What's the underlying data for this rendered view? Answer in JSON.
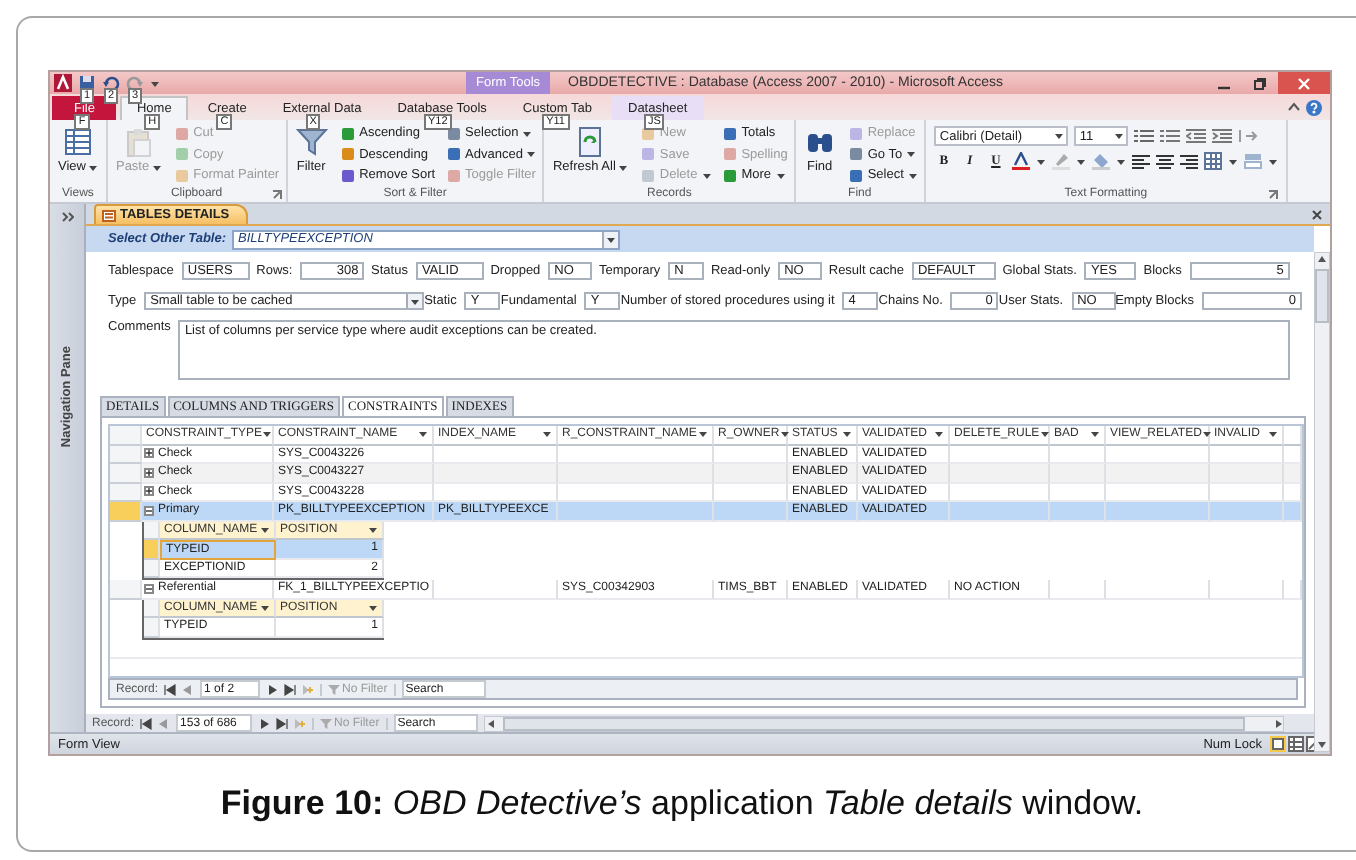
{
  "window": {
    "title": "OBDDETECTIVE : Database (Access 2007 - 2010) - Microsoft Access",
    "context_label": "Form Tools"
  },
  "quick_access": [
    {
      "keytip": "1"
    },
    {
      "keytip": "2"
    },
    {
      "keytip": "3"
    }
  ],
  "ribbon_tabs": [
    {
      "label": "File",
      "keytip": "F",
      "kind": "file",
      "selected": false
    },
    {
      "label": "Home",
      "keytip": "H",
      "kind": "normal",
      "selected": true
    },
    {
      "label": "Create",
      "keytip": "C",
      "kind": "normal",
      "selected": false
    },
    {
      "label": "External Data",
      "keytip": "X",
      "kind": "normal",
      "selected": false
    },
    {
      "label": "Database Tools",
      "keytip": "Y12",
      "kind": "normal",
      "selected": false
    },
    {
      "label": "Custom Tab",
      "keytip": "Y11",
      "kind": "normal",
      "selected": false
    },
    {
      "label": "Datasheet",
      "keytip": "JS",
      "kind": "context",
      "selected": false
    }
  ],
  "ribbon_groups": [
    {
      "label": "Views",
      "launcher": false,
      "items": [
        {
          "label": "View",
          "kind": "large",
          "dropdown": true,
          "disabled": false
        }
      ]
    },
    {
      "label": "Clipboard",
      "launcher": true,
      "items": [
        {
          "label": "Paste",
          "kind": "large",
          "dropdown": true,
          "disabled": true
        },
        {
          "label": "Cut",
          "kind": "small",
          "dropdown": false,
          "disabled": true
        },
        {
          "label": "Copy",
          "kind": "small",
          "dropdown": false,
          "disabled": true
        },
        {
          "label": "Format Painter",
          "kind": "small",
          "dropdown": false,
          "disabled": true
        }
      ]
    },
    {
      "label": "Sort & Filter",
      "launcher": false,
      "items": [
        {
          "label": "Filter",
          "kind": "large",
          "dropdown": false,
          "disabled": false
        },
        {
          "label": "Ascending",
          "kind": "small",
          "dropdown": false,
          "disabled": false
        },
        {
          "label": "Descending",
          "kind": "small",
          "dropdown": false,
          "disabled": false
        },
        {
          "label": "Remove Sort",
          "kind": "small",
          "dropdown": false,
          "disabled": false
        },
        {
          "label": "Selection",
          "kind": "small",
          "dropdown": true,
          "disabled": false
        },
        {
          "label": "Advanced",
          "kind": "small",
          "dropdown": true,
          "disabled": false
        },
        {
          "label": "Toggle Filter",
          "kind": "small",
          "dropdown": false,
          "disabled": true
        }
      ]
    },
    {
      "label": "Records",
      "launcher": false,
      "items": [
        {
          "label": "Refresh All",
          "kind": "large",
          "dropdown": true,
          "disabled": false
        },
        {
          "label": "New",
          "kind": "small",
          "dropdown": false,
          "disabled": true
        },
        {
          "label": "Save",
          "kind": "small",
          "dropdown": false,
          "disabled": true
        },
        {
          "label": "Delete",
          "kind": "small",
          "dropdown": true,
          "disabled": true
        },
        {
          "label": "Totals",
          "kind": "small",
          "dropdown": false,
          "disabled": false
        },
        {
          "label": "Spelling",
          "kind": "small",
          "dropdown": false,
          "disabled": true
        },
        {
          "label": "More",
          "kind": "small",
          "dropdown": true,
          "disabled": false
        }
      ]
    },
    {
      "label": "Find",
      "launcher": false,
      "items": [
        {
          "label": "Find",
          "kind": "large",
          "dropdown": false,
          "disabled": false
        },
        {
          "label": "Replace",
          "kind": "small",
          "dropdown": false,
          "disabled": true
        },
        {
          "label": "Go To",
          "kind": "small",
          "dropdown": true,
          "disabled": false
        },
        {
          "label": "Select",
          "kind": "small",
          "dropdown": true,
          "disabled": false
        }
      ]
    }
  ],
  "text_formatting": {
    "label": "Text Formatting",
    "launcher": true,
    "font": "Calibri (Detail)",
    "size": "11",
    "style_buttons": [
      "B",
      "I",
      "U"
    ]
  },
  "navigation_pane": {
    "label": "Navigation Pane"
  },
  "document_tab": {
    "label": "TABLES DETAILS"
  },
  "table_selector": {
    "label": "Select Other Table:",
    "value": "BILLTYPEEXCEPTION"
  },
  "field_rows": [
    [
      {
        "label": "Tablespace",
        "value": "USERS",
        "kind": "text"
      },
      {
        "label": "Rows:",
        "value": "308",
        "kind": "number"
      },
      {
        "label": "Status",
        "value": "VALID",
        "kind": "text"
      },
      {
        "label": "Dropped",
        "value": "NO",
        "kind": "text"
      },
      {
        "label": "Temporary",
        "value": "N",
        "kind": "text"
      },
      {
        "label": "Read-only",
        "value": "NO",
        "kind": "text"
      },
      {
        "label": "Result cache",
        "value": "DEFAULT",
        "kind": "text"
      },
      {
        "label": "Global Stats.",
        "value": "YES",
        "kind": "text"
      },
      {
        "label": "Blocks",
        "value": "5",
        "kind": "number"
      }
    ],
    [
      {
        "label": "Type",
        "value": "Small table to be cached",
        "kind": "combo"
      },
      {
        "label": "Static",
        "value": "Y",
        "kind": "text"
      },
      {
        "label": "Fundamental",
        "value": "Y",
        "kind": "text"
      },
      {
        "label": "Number of stored procedures using it",
        "value": "4",
        "kind": "text"
      },
      {
        "label": "Chains No.",
        "value": "0",
        "kind": "number"
      },
      {
        "label": "User Stats.",
        "value": "NO",
        "kind": "text"
      },
      {
        "label": "Empty Blocks",
        "value": "0",
        "kind": "number"
      }
    ]
  ],
  "comments": {
    "label": "Comments",
    "value": "List of columns per service type where audit exceptions can be created."
  },
  "subform_tabs": [
    {
      "label": "DETAILS",
      "selected": false
    },
    {
      "label": "COLUMNS AND TRIGGERS",
      "selected": false
    },
    {
      "label": "CONSTRAINTS",
      "selected": true
    },
    {
      "label": "INDEXES",
      "selected": false
    }
  ],
  "datasheet": {
    "columns": [
      "CONSTRAINT_TYPE",
      "CONSTRAINT_NAME",
      "INDEX_NAME",
      "R_CONSTRAINT_NAME",
      "R_OWNER",
      "STATUS",
      "VALIDATED",
      "DELETE_RULE",
      "BAD",
      "VIEW_RELATED",
      "INVALID"
    ],
    "rows": [
      {
        "cells": [
          "Check",
          "SYS_C0043226",
          null,
          null,
          null,
          "ENABLED",
          "VALIDATED",
          null,
          null,
          null,
          null
        ],
        "expanded": false,
        "selected": false
      },
      {
        "cells": [
          "Check",
          "SYS_C0043227",
          null,
          null,
          null,
          "ENABLED",
          "VALIDATED",
          null,
          null,
          null,
          null
        ],
        "expanded": false,
        "selected": false
      },
      {
        "cells": [
          "Check",
          "SYS_C0043228",
          null,
          null,
          null,
          "ENABLED",
          "VALIDATED",
          null,
          null,
          null,
          null
        ],
        "expanded": false,
        "selected": false
      },
      {
        "cells": [
          "Primary",
          "PK_BILLTYPEEXCEPTION",
          "PK_BILLTYPEEXCE",
          null,
          null,
          "ENABLED",
          "VALIDATED",
          null,
          null,
          null,
          null
        ],
        "expanded": true,
        "selected": true,
        "subtable": {
          "columns": [
            "COLUMN_NAME",
            "POSITION"
          ],
          "rows": [
            {
              "cells": [
                "TYPEID",
                "1"
              ],
              "selected": true
            },
            {
              "cells": [
                "EXCEPTIONID",
                "2"
              ],
              "selected": false
            }
          ]
        }
      },
      {
        "cells": [
          "Referential",
          "FK_1_BILLTYPEEXCEPTIO",
          null,
          "SYS_C00342903",
          "TIMS_BBT",
          "ENABLED",
          "VALIDATED",
          "NO ACTION",
          null,
          null,
          null
        ],
        "expanded": true,
        "selected": false,
        "subtable": {
          "columns": [
            "COLUMN_NAME",
            "POSITION"
          ],
          "rows": [
            {
              "cells": [
                "TYPEID",
                "1"
              ],
              "selected": false
            }
          ]
        }
      }
    ]
  },
  "subform_navigation": {
    "label": "Record:",
    "position": "1 of 2",
    "filter": "No Filter",
    "search_placeholder": "Search"
  },
  "form_navigation": {
    "label": "Record:",
    "position": "153 of 686",
    "filter": "No Filter",
    "search_placeholder": "Search"
  },
  "status_bar": {
    "view": "Form View",
    "indicator": "Num Lock"
  },
  "caption": "**Figure 10:** *OBD Detective’s* application *Table details* window."
}
